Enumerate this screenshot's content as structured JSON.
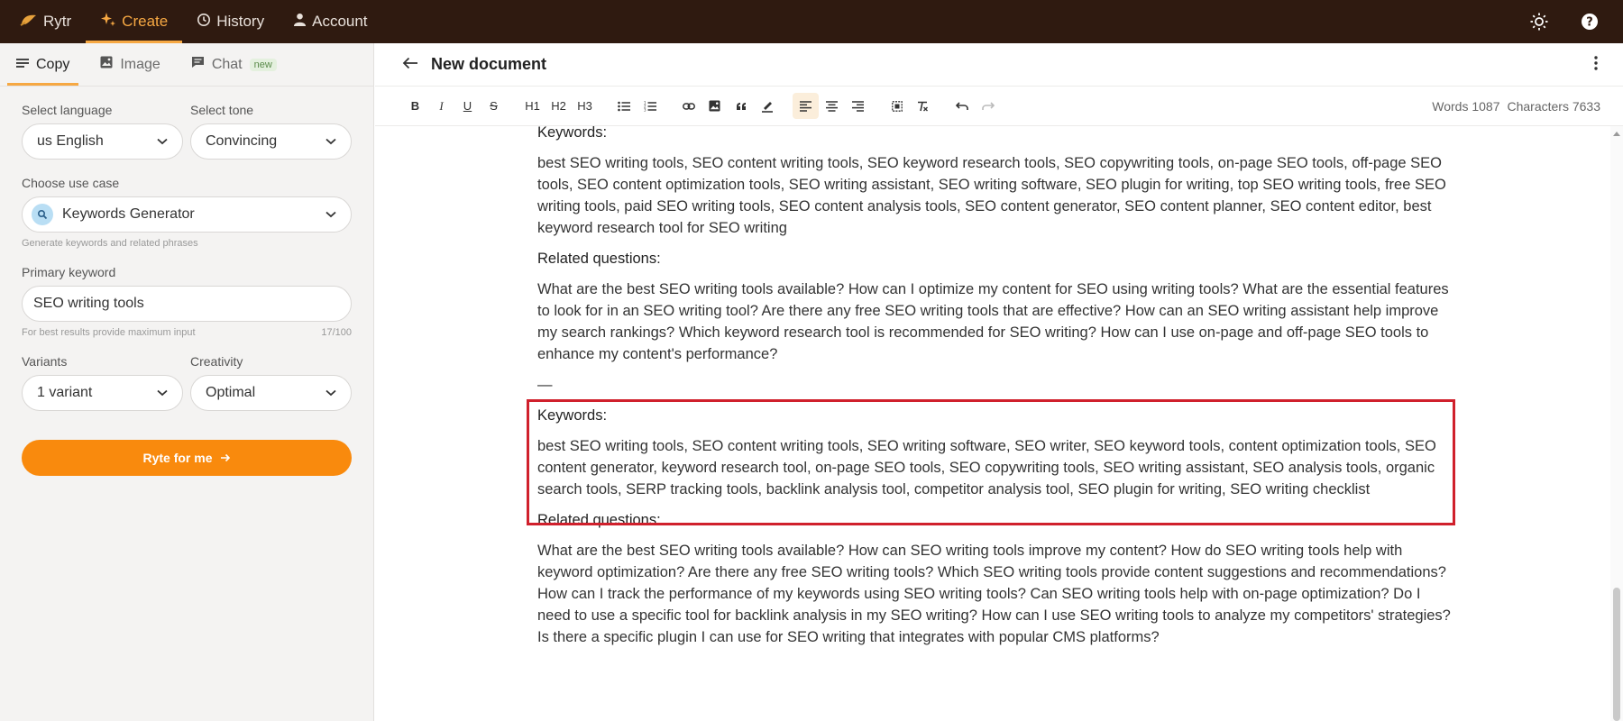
{
  "topbar": {
    "logo": "Rytr",
    "create": "Create",
    "history": "History",
    "account": "Account"
  },
  "left_tabs": {
    "copy": "Copy",
    "image": "Image",
    "chat": "Chat",
    "chat_badge": "new"
  },
  "form": {
    "language_label": "Select language",
    "language_value": "us English",
    "tone_label": "Select tone",
    "tone_value": "Convincing",
    "usecase_label": "Choose use case",
    "usecase_value": "Keywords Generator",
    "usecase_hint": "Generate keywords and related phrases",
    "keyword_label": "Primary keyword",
    "keyword_value": "SEO writing tools",
    "keyword_hint": "For best results provide maximum input",
    "keyword_count": "17/100",
    "variants_label": "Variants",
    "variants_value": "1 variant",
    "creativity_label": "Creativity",
    "creativity_value": "Optimal",
    "submit_label": "Ryte for me"
  },
  "document": {
    "title": "New document",
    "words": "Words 1087",
    "characters": "Characters 7633"
  },
  "toolbar": {
    "bold": "B",
    "italic": "I",
    "underline": "U",
    "strike": "S",
    "h1": "H1",
    "h2": "H2",
    "h3": "H3"
  },
  "content": {
    "kw1_heading": "Keywords:",
    "kw1_text": "best SEO writing tools, SEO content writing tools, SEO keyword research tools, SEO copywriting tools, on-page SEO tools, off-page SEO tools, SEO content optimization tools, SEO writing assistant, SEO writing software, SEO plugin for writing, top SEO writing tools, free SEO writing tools, paid SEO writing tools, SEO content analysis tools, SEO content generator, SEO content planner, SEO content editor, best keyword research tool for SEO writing",
    "rq1_heading": "Related questions:",
    "rq1_text": "What are the best SEO writing tools available? How can I optimize my content for SEO using writing tools? What are the essential features to look for in an SEO writing tool? Are there any free SEO writing tools that are effective? How can an SEO writing assistant help improve my search rankings? Which keyword research tool is recommended for SEO writing? How can I use on-page and off-page SEO tools to enhance my content's performance?",
    "divider": "—",
    "kw2_heading": "Keywords:",
    "kw2_text": "best SEO writing tools, SEO content writing tools, SEO writing software, SEO writer, SEO keyword tools, content optimization tools, SEO content generator, keyword research tool, on-page SEO tools, SEO copywriting tools, SEO writing assistant, SEO analysis tools, organic search tools, SERP tracking tools, backlink analysis tool, competitor analysis tool, SEO plugin for writing, SEO writing checklist",
    "rq2_heading": "Related questions:",
    "rq2_text": "What are the best SEO writing tools available? How can SEO writing tools improve my content? How do SEO writing tools help with keyword optimization? Are there any free SEO writing tools? Which SEO writing tools provide content suggestions and recommendations? How can I track the performance of my keywords using SEO writing tools? Can SEO writing tools help with on-page optimization? Do I need to use a specific tool for backlink analysis in my SEO writing? How can I use SEO writing tools to analyze my competitors' strategies? Is there a specific plugin I can use for SEO writing that integrates with popular CMS platforms?"
  },
  "colors": {
    "topbar_bg": "#2f1a10",
    "accent": "#f6a843",
    "button": "#f98a0d",
    "highlight_box": "#d0202c"
  }
}
